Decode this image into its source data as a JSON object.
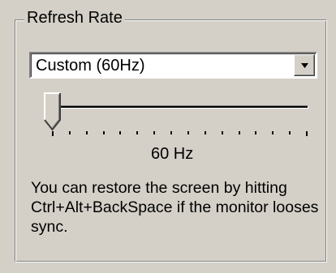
{
  "groupbox": {
    "title": "Refresh Rate"
  },
  "refresh_combo": {
    "selected": "Custom (60Hz)"
  },
  "slider": {
    "level": 0,
    "tick_count": 16
  },
  "value_label": "60 Hz",
  "help_text": "You can restore the screen by hitting Ctrl+Alt+BackSpace if the monitor looses sync.",
  "colors": {
    "face": "#d4d0c8",
    "shadow": "#808080",
    "highlight": "#ffffff"
  },
  "icons": {
    "combo_button": "chevron-down-icon"
  }
}
